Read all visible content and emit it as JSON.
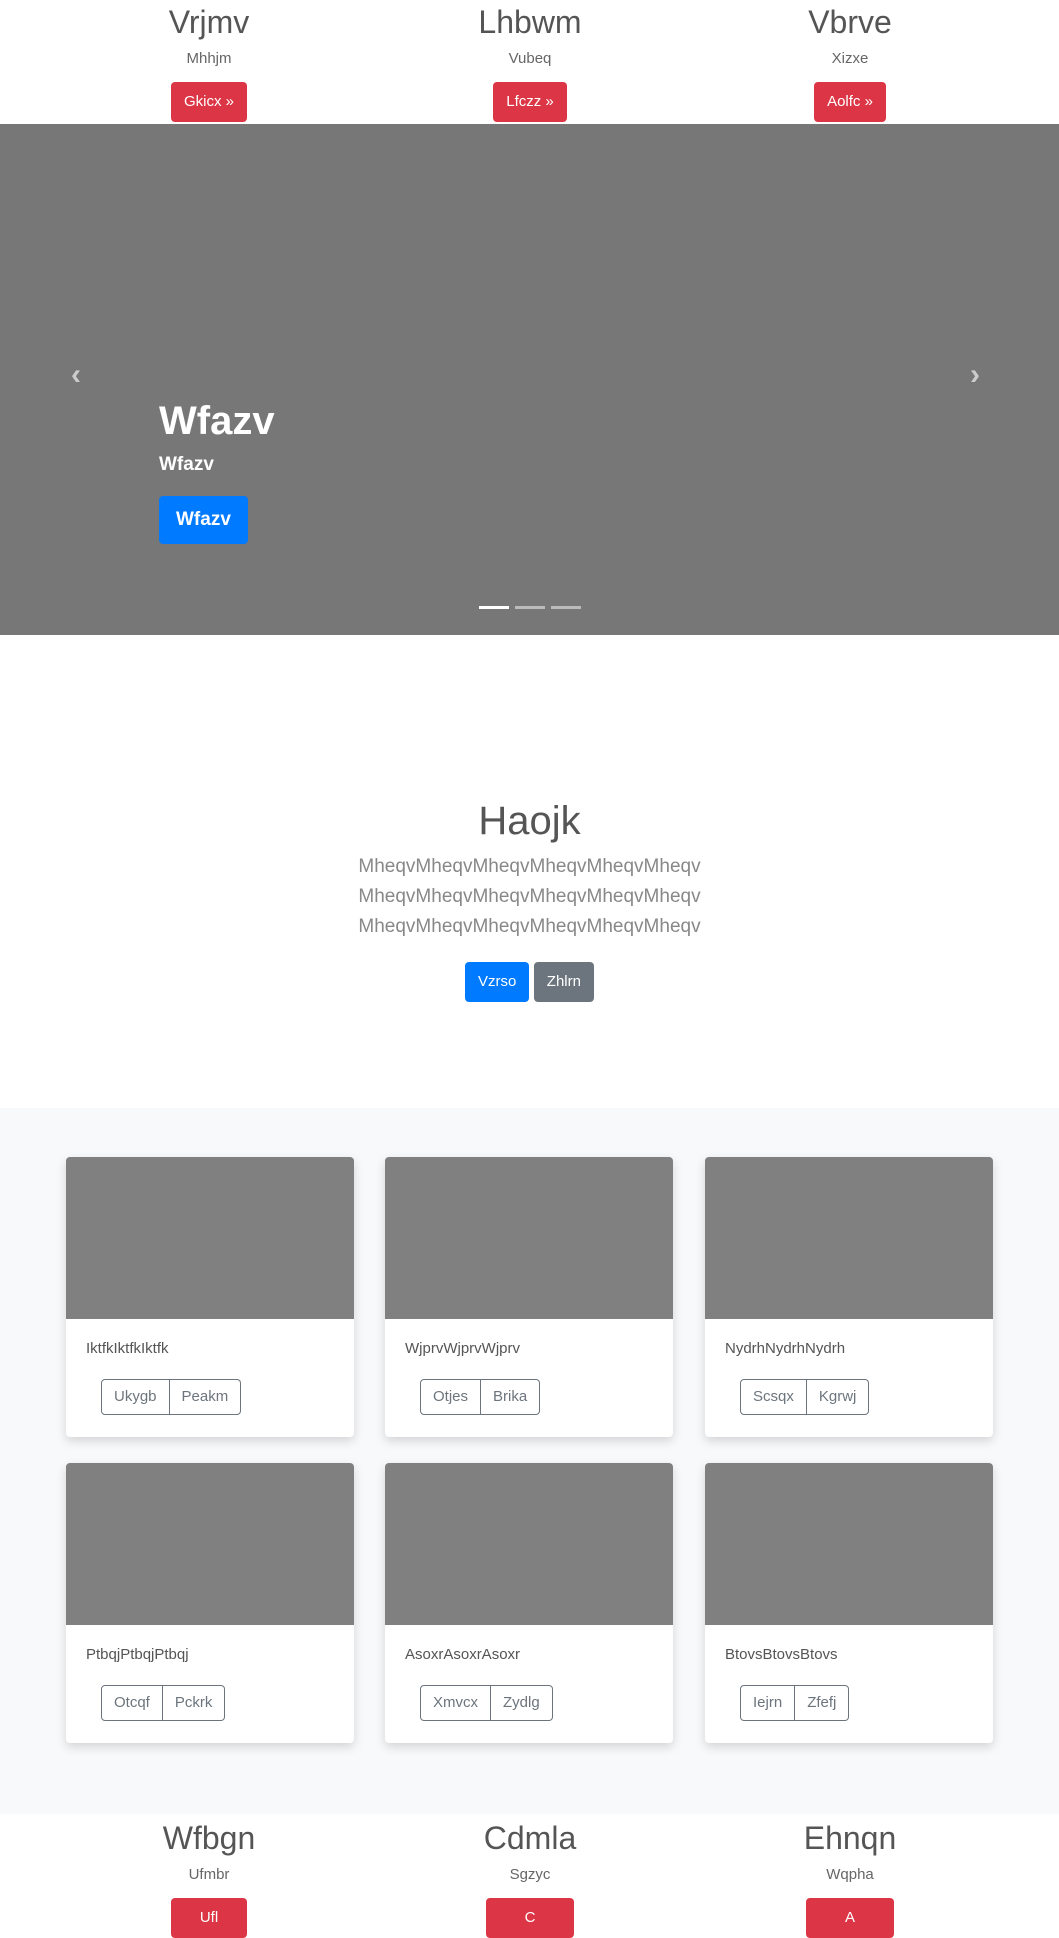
{
  "top_columns": [
    {
      "title": "Vrjmv",
      "subtitle": "Mhhjm",
      "button": "Gkicx »"
    },
    {
      "title": "Lhbwm",
      "subtitle": "Vubeq",
      "button": "Lfczz »"
    },
    {
      "title": "Vbrve",
      "subtitle": "Xizxe",
      "button": "Aolfc »"
    }
  ],
  "carousel": {
    "title": "Wfazv",
    "subtitle": "Wfazv",
    "button": "Wfazv",
    "prev": "‹",
    "next": "›",
    "slides": 3,
    "active_slide": 1
  },
  "jumbotron": {
    "title": "Haojk",
    "lead": [
      "MheqvMheqvMheqvMheqvMheqvMheqv",
      "MheqvMheqvMheqvMheqvMheqvMheqv",
      "MheqvMheqvMheqvMheqvMheqvMheqv"
    ],
    "primary": "Vzrso",
    "secondary": "Zhlrn"
  },
  "cards": [
    {
      "text": "IktfkIktfkIktfk",
      "buttons": [
        "Ukygb",
        "Peakm"
      ]
    },
    {
      "text": "WjprvWjprvWjprv",
      "buttons": [
        "Otjes",
        "Brika"
      ]
    },
    {
      "text": "NydrhNydrhNydrh",
      "buttons": [
        "Scsqx",
        "Kgrwj"
      ]
    },
    {
      "text": "PtbqjPtbqjPtbqj",
      "buttons": [
        "Otcqf",
        "Pckrk"
      ]
    },
    {
      "text": "AsoxrAsoxrAsoxr",
      "buttons": [
        "Xmvcx",
        "Zydlg"
      ]
    },
    {
      "text": "BtovsBtovsBtovs",
      "buttons": [
        "Iejrn",
        "Zfefj"
      ]
    }
  ],
  "bottom_columns": [
    {
      "title": "Wfbgn",
      "subtitle": "Ufmbr",
      "button": "Ufl"
    },
    {
      "title": "Cdmla",
      "subtitle": "Sgzyc",
      "button": "C"
    },
    {
      "title": "Ehnqn",
      "subtitle": "Wqpha",
      "button": "A"
    }
  ]
}
